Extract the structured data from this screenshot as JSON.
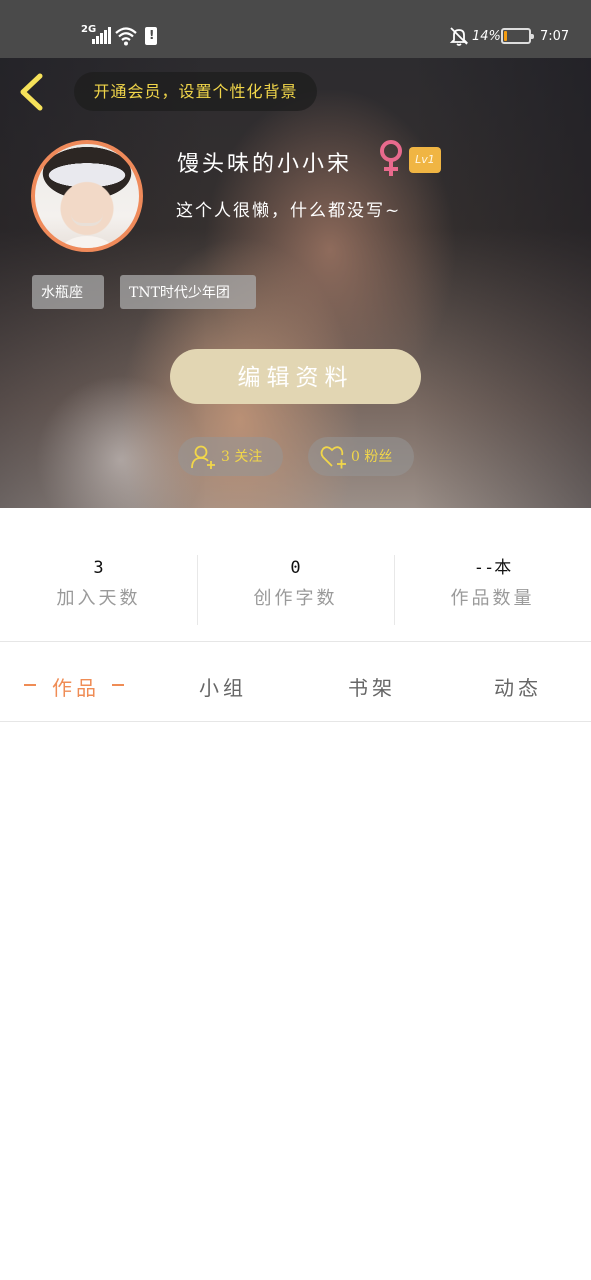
{
  "status_bar": {
    "network": "2G",
    "battery_percent": "14%",
    "battery_level": 0.14,
    "time": "7:07",
    "icons": [
      "signal-icon",
      "wifi-icon",
      "notification-icon",
      "mute-bell-icon",
      "battery-icon"
    ]
  },
  "nav": {
    "back_icon": "chevron-left-icon",
    "vip_banner": "开通会员，设置个性化背景"
  },
  "profile": {
    "nickname": "馒头味的小小宋",
    "gender_icon": "female-icon",
    "level": "Lv1",
    "bio": "这个人很懒，什么都没写~",
    "tags": [
      "水瓶座",
      "TNT时代少年团"
    ],
    "edit_button": "编辑资料",
    "following_label": "3 关注",
    "fans_label": "0 粉丝"
  },
  "stats": [
    {
      "value": "3",
      "label": "加入天数"
    },
    {
      "value": "0",
      "label": "创作字数"
    },
    {
      "value": "--本",
      "label": "作品数量"
    }
  ],
  "tabs": {
    "active_index": 0,
    "items": [
      "作品",
      "小组",
      "书架",
      "动态"
    ]
  },
  "colors": {
    "accent": "#ef8c55",
    "gold_text": "#f1d64a",
    "edit_button_bg": "#e2d6b3",
    "level_badge": "#f0b543",
    "gender_female": "#e86a8d",
    "back_icon": "#f6e25a"
  }
}
